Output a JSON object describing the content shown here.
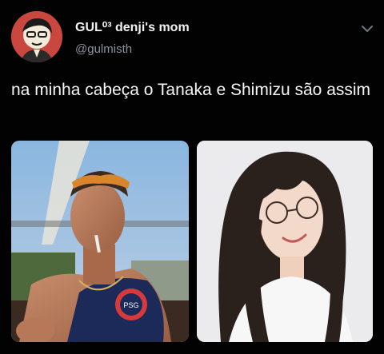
{
  "tweet": {
    "author": {
      "display_name": "GUL⁰³ denji's mom",
      "handle": "@gulmisth"
    },
    "text": "na minha cabeça o Tanaka e Shimizu são assim",
    "menu_icon": "chevron-down-icon",
    "avatar_icon": "avatar-illustration",
    "media": [
      {
        "name": "photo-man-sunglasses"
      },
      {
        "name": "photo-woman-glasses"
      }
    ]
  },
  "colors": {
    "background": "#020202",
    "name": "#f2f2f2",
    "handle": "#8a949c",
    "text": "#f5f5f5",
    "avatar_bg": "#c9473f"
  }
}
